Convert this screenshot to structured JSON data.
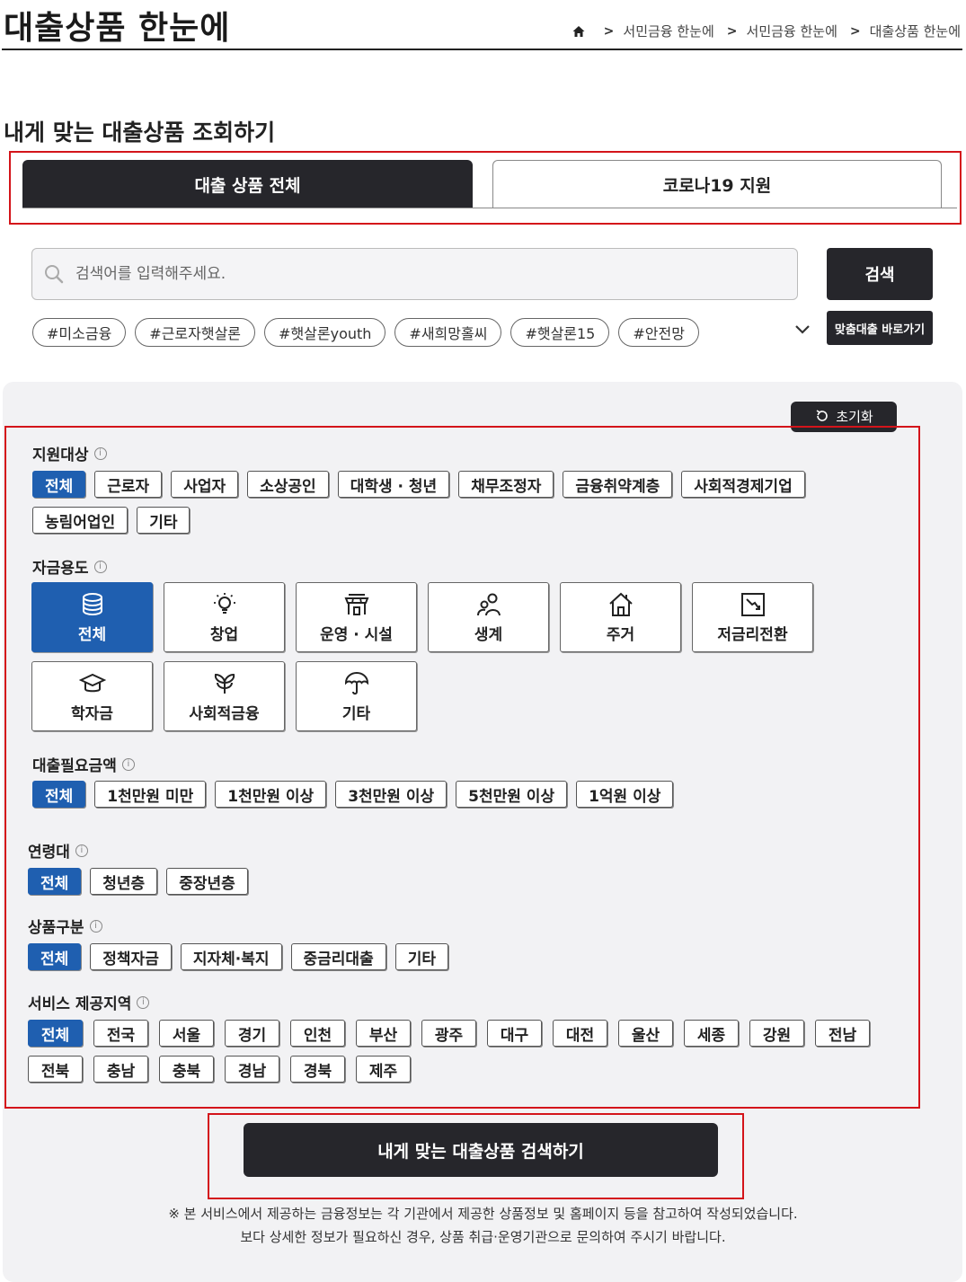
{
  "header": {
    "title": "대출상품 한눈에",
    "breadcrumb": [
      "서민금융 한눈에",
      "서민금융 한눈에",
      "대출상품 한눈에"
    ]
  },
  "section_title": "내게 맞는 대출상품 조회하기",
  "tabs": [
    {
      "label": "대출 상품 전체",
      "active": true
    },
    {
      "label": "코로나19 지원",
      "active": false
    }
  ],
  "search": {
    "placeholder": "검색어를 입력해주세요.",
    "button": "검색",
    "hashtags": [
      "#미소금융",
      "#근로자햇살론",
      "#햇살론youth",
      "#새희망홀씨",
      "#햇살론15",
      "#안전망"
    ],
    "direct_button": "맞춤대출 바로가기"
  },
  "reset_label": "초기화",
  "filters": {
    "target": {
      "label": "지원대상",
      "options": [
        "전체",
        "근로자",
        "사업자",
        "소상공인",
        "대학생 · 청년",
        "채무조정자",
        "금융취약계층",
        "사회적경제기업",
        "농림어업인",
        "기타"
      ],
      "selected": "전체"
    },
    "purpose": {
      "label": "자금용도",
      "options": [
        {
          "label": "전체",
          "icon": "coins-icon"
        },
        {
          "label": "창업",
          "icon": "lightbulb-icon"
        },
        {
          "label": "운영 · 시설",
          "icon": "store-icon"
        },
        {
          "label": "생계",
          "icon": "people-icon"
        },
        {
          "label": "주거",
          "icon": "house-icon"
        },
        {
          "label": "저금리전환",
          "icon": "trend-down-icon"
        },
        {
          "label": "학자금",
          "icon": "graduation-cap-icon"
        },
        {
          "label": "사회적금융",
          "icon": "sprout-icon"
        },
        {
          "label": "기타",
          "icon": "umbrella-icon"
        }
      ],
      "selected": "전체"
    },
    "amount": {
      "label": "대출필요금액",
      "options": [
        "전체",
        "1천만원 미만",
        "1천만원 이상",
        "3천만원 이상",
        "5천만원 이상",
        "1억원 이상"
      ],
      "selected": "전체"
    },
    "age": {
      "label": "연령대",
      "options": [
        "전체",
        "청년층",
        "중장년층"
      ],
      "selected": "전체"
    },
    "product_type": {
      "label": "상품구분",
      "options": [
        "전체",
        "정책자금",
        "지자체·복지",
        "중금리대출",
        "기타"
      ],
      "selected": "전체"
    },
    "region": {
      "label": "서비스 제공지역",
      "options": [
        "전체",
        "전국",
        "서울",
        "경기",
        "인천",
        "부산",
        "광주",
        "대구",
        "대전",
        "울산",
        "세종",
        "강원",
        "전남",
        "전북",
        "충남",
        "충북",
        "경남",
        "경북",
        "제주"
      ],
      "selected": "전체"
    }
  },
  "submit_label": "내게 맞는 대출상품 검색하기",
  "notice": [
    "※ 본 서비스에서 제공하는 금융정보는 각 기관에서 제공한 상품정보 및 홈페이지 등을 참고하여 작성되었습니다.",
    "보다 상세한 정보가 필요하신 경우, 상품 취급·운영기관으로 문의하여 주시기 바랍니다."
  ],
  "colors": {
    "accent": "#1f5fb0",
    "dark": "#26262b",
    "highlight": "#d4141a"
  }
}
